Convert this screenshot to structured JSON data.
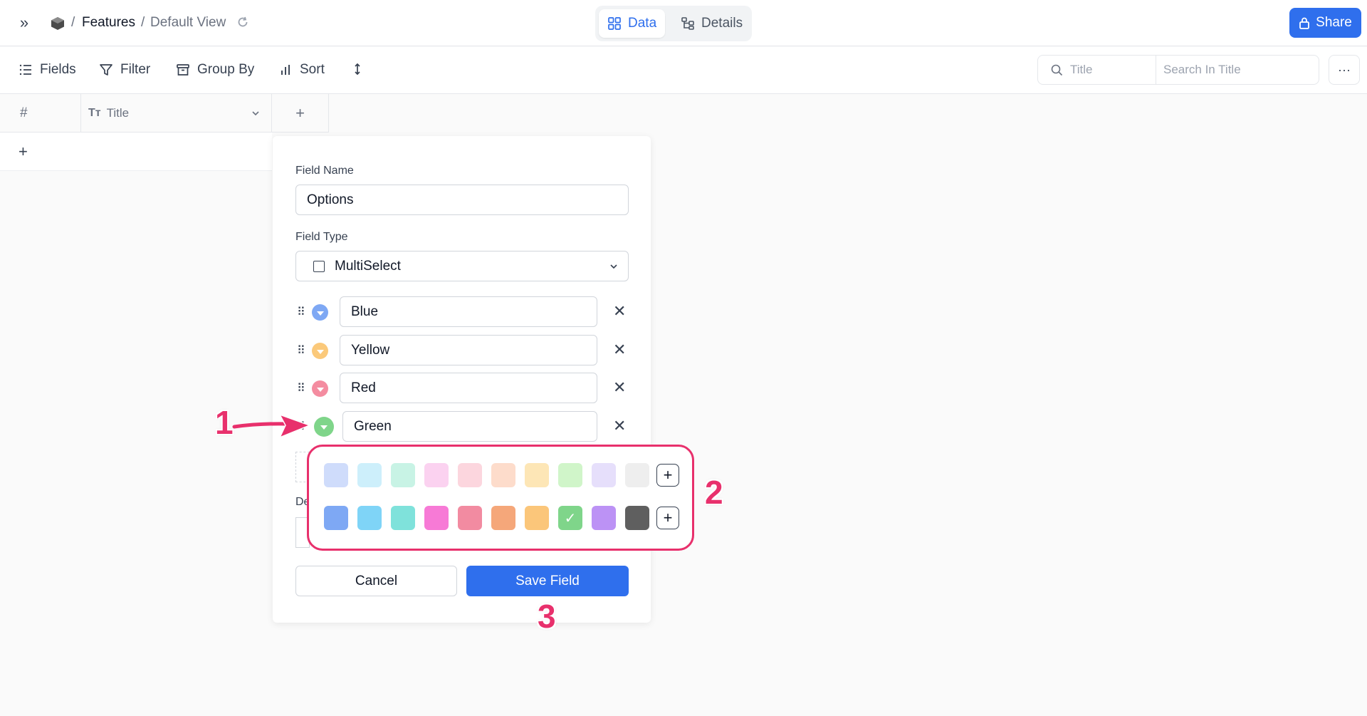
{
  "header": {
    "breadcrumb_sep": "/",
    "table_name": "Features",
    "view_name": "Default View",
    "tabs": [
      {
        "label": "Data",
        "icon": "grid-icon",
        "active": true
      },
      {
        "label": "Details",
        "icon": "details-icon",
        "active": false
      }
    ],
    "share_label": "Share"
  },
  "toolbar": {
    "fields_label": "Fields",
    "filter_label": "Filter",
    "group_by_label": "Group By",
    "sort_label": "Sort",
    "search_field_label": "Title",
    "search_placeholder": "Search In Title",
    "more_label": "···"
  },
  "grid": {
    "columns": [
      {
        "label": "#"
      },
      {
        "label": "Title",
        "type_icon": "Tт"
      }
    ],
    "add_column": "+",
    "add_row": "+"
  },
  "field_editor": {
    "field_name_label": "Field Name",
    "field_name_value": "Options",
    "field_type_label": "Field Type",
    "field_type_value": "MultiSelect",
    "options": [
      {
        "label": "Blue",
        "color": "#7ea8f4"
      },
      {
        "label": "Yellow",
        "color": "#fbc97a"
      },
      {
        "label": "Red",
        "color": "#f48ca0"
      },
      {
        "label": "Green",
        "color": "#7fd58a"
      }
    ],
    "hidden_label_fragment": "De",
    "cancel_label": "Cancel",
    "save_label": "Save Field"
  },
  "color_picker": {
    "light_colors": [
      "#cfdcfb",
      "#cdeffb",
      "#c8f3e5",
      "#fbd2f0",
      "#fcd6de",
      "#fddccb",
      "#fde6b6",
      "#d0f5c9",
      "#e6dffb",
      "#eeeeee"
    ],
    "dark_colors": [
      "#7ea8f4",
      "#7fd4f7",
      "#7fe2db",
      "#f77ad6",
      "#f28ba1",
      "#f5a77a",
      "#fbc67a",
      "#7fd58a",
      "#bc92f5",
      "#5f5f5f"
    ],
    "selected_dark_index": 7,
    "add_label": "+"
  },
  "annotations": {
    "step1": "1",
    "step2": "2",
    "step3": "3",
    "accent": "#e8306c"
  }
}
